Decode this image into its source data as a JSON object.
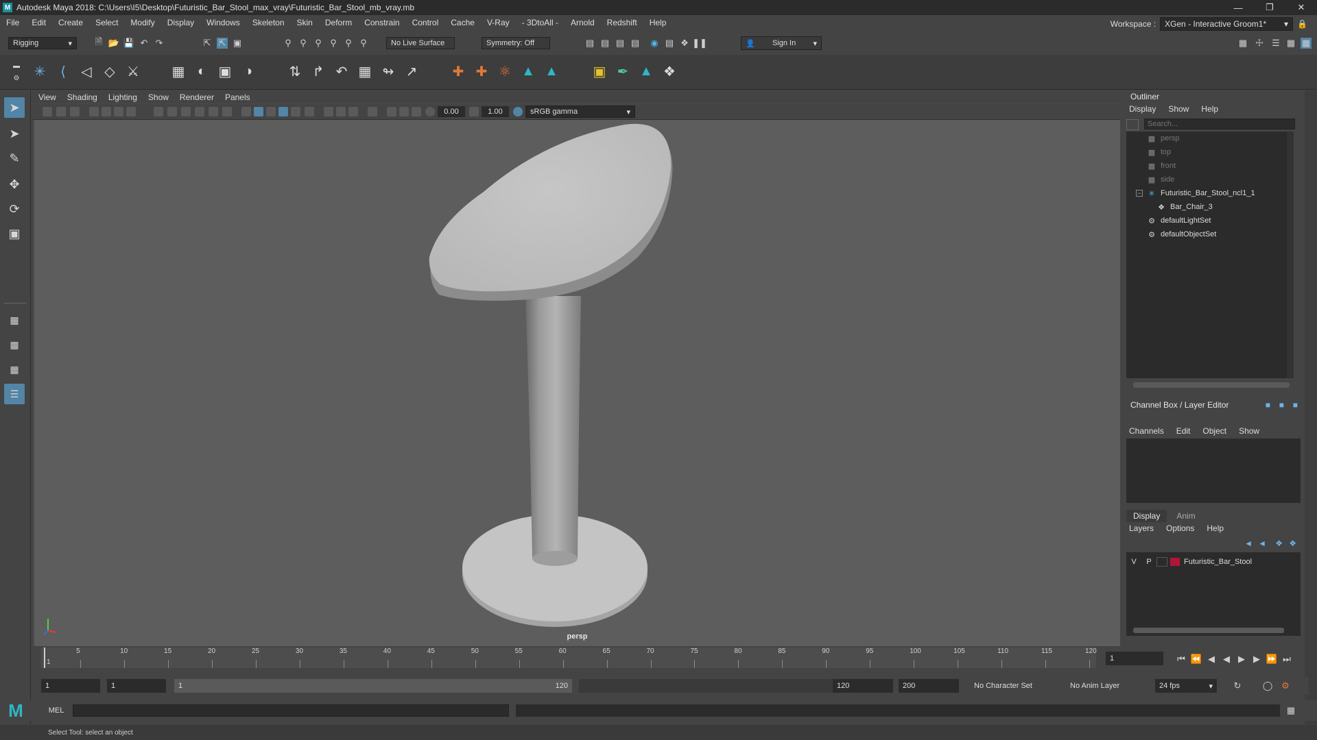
{
  "window": {
    "title": "Autodesk Maya 2018: C:\\Users\\I5\\Desktop\\Futuristic_Bar_Stool_max_vray\\Futuristic_Bar_Stool_mb_vray.mb",
    "logo": "M"
  },
  "menubar": {
    "items": [
      "File",
      "Edit",
      "Create",
      "Select",
      "Modify",
      "Display",
      "Windows",
      "Skeleton",
      "Skin",
      "Deform",
      "Constrain",
      "Control",
      "Cache",
      "V-Ray",
      "- 3DtoAll -",
      "Arnold",
      "Redshift",
      "Help"
    ],
    "workspace_label": "Workspace :",
    "workspace_value": "XGen - Interactive Groom1*"
  },
  "statusline": {
    "mode": "Rigging",
    "live_surface": "No Live Surface",
    "symmetry": "Symmetry: Off",
    "sign_in": "Sign In"
  },
  "viewport": {
    "menus": [
      "View",
      "Shading",
      "Lighting",
      "Show",
      "Renderer",
      "Panels"
    ],
    "exposure": "0.00",
    "gamma": "1.00",
    "color_space": "sRGB gamma",
    "camera_label": "persp"
  },
  "outliner": {
    "title": "Outliner",
    "menus": [
      "Display",
      "Show",
      "Help"
    ],
    "search_placeholder": "Search...",
    "items": [
      {
        "label": "persp",
        "icon": "camera-icon",
        "dim": true
      },
      {
        "label": "top",
        "icon": "camera-icon",
        "dim": true
      },
      {
        "label": "front",
        "icon": "camera-icon",
        "dim": true
      },
      {
        "label": "side",
        "icon": "camera-icon",
        "dim": true
      },
      {
        "label": "Futuristic_Bar_Stool_ncl1_1",
        "icon": "group-icon",
        "dim": false
      },
      {
        "label": "Bar_Chair_3",
        "icon": "mesh-icon",
        "dim": false
      },
      {
        "label": "defaultLightSet",
        "icon": "set-icon",
        "dim": false
      },
      {
        "label": "defaultObjectSet",
        "icon": "set-icon",
        "dim": false
      }
    ]
  },
  "channelbox": {
    "title": "Channel Box / Layer Editor",
    "menus": [
      "Channels",
      "Edit",
      "Object",
      "Show"
    ],
    "tabs": [
      "Display",
      "Anim"
    ],
    "layer_menus": [
      "Layers",
      "Options",
      "Help"
    ],
    "layer": {
      "v": "V",
      "p": "P",
      "name": "Futuristic_Bar_Stool",
      "color": "#b0163a"
    }
  },
  "timeline": {
    "ticks": [
      "5",
      "10",
      "15",
      "20",
      "25",
      "30",
      "35",
      "40",
      "45",
      "50",
      "55",
      "60",
      "65",
      "70",
      "75",
      "80",
      "85",
      "90",
      "95",
      "100",
      "105",
      "110",
      "115",
      "120"
    ],
    "start_marker": "1",
    "current_frame": "1"
  },
  "range": {
    "start": "1",
    "playback_start": "1",
    "slider_start": "1",
    "slider_end": "120",
    "playback_end": "120",
    "end": "200",
    "character_set": "No Character Set",
    "anim_layer": "No Anim Layer",
    "fps": "24 fps"
  },
  "cmdline": {
    "label": "MEL",
    "help": "Select Tool: select an object"
  }
}
